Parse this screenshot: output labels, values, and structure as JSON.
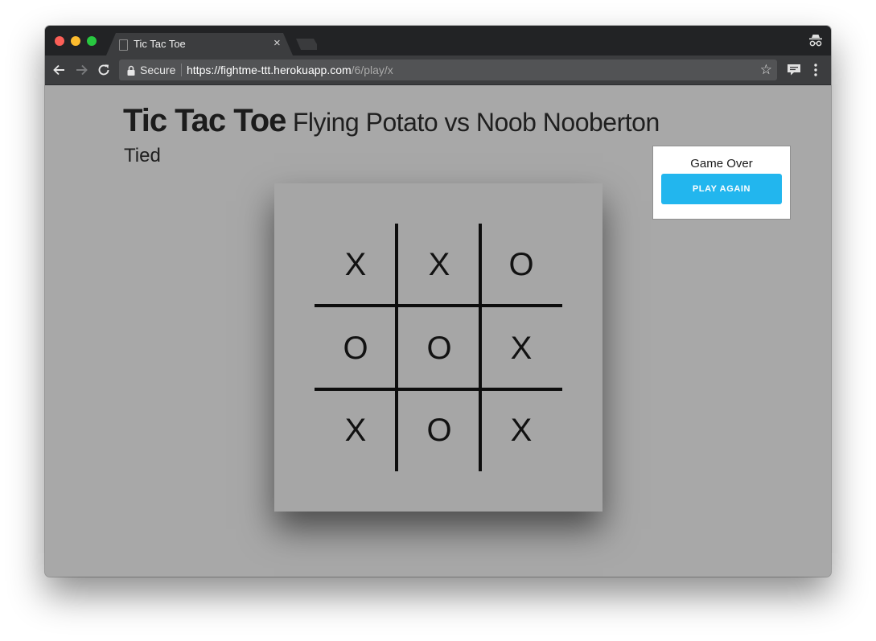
{
  "browser": {
    "tab_title": "Tic Tac Toe",
    "tab_close": "×",
    "security_label": "Secure",
    "url_host": "https://fightme-ttt.herokuapp.com",
    "url_path": "/6/play/x",
    "bookmark_icon": "☆"
  },
  "page": {
    "title": "Tic Tac Toe",
    "players": "Flying Potato vs Noob Nooberton",
    "status": "Tied"
  },
  "board": {
    "cells": [
      "X",
      "X",
      "O",
      "O",
      "O",
      "X",
      "X",
      "O",
      "X"
    ]
  },
  "game_over": {
    "label": "Game Over",
    "button_label": "PLAY AGAIN",
    "button_color": "#22b6ee"
  },
  "colors": {
    "page_background": "#a8a8a8",
    "browser_chrome": "#3c3d3f"
  }
}
